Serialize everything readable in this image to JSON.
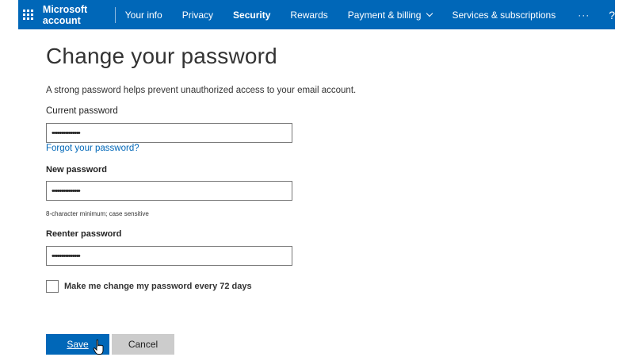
{
  "header": {
    "brand": "Microsoft account",
    "nav": [
      {
        "label": "Your info"
      },
      {
        "label": "Privacy"
      },
      {
        "label": "Security"
      },
      {
        "label": "Rewards"
      },
      {
        "label": "Payment & billing"
      },
      {
        "label": "Services & subscriptions"
      }
    ],
    "more": "···",
    "help": "?",
    "active_item": "Security",
    "color": "#0067b8"
  },
  "page": {
    "title": "Change your password",
    "description": "A strong password helps prevent unauthorized access to your email account."
  },
  "form": {
    "current_label": "Current password",
    "current_value": "•••••••••••••••",
    "forgot_link": "Forgot your password?",
    "new_label": "New password",
    "new_value": "•••••••••••••••",
    "hint": "8-character minimum; case sensitive",
    "reenter_label": "Reenter password",
    "reenter_value": "•••••••••••••••",
    "checkbox_label": "Make me change my password every 72 days",
    "checkbox_checked": false
  },
  "buttons": {
    "save": "Save",
    "cancel": "Cancel"
  }
}
